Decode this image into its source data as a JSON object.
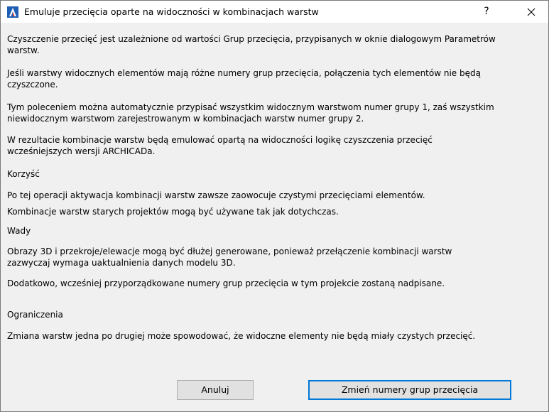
{
  "window": {
    "title": "Emuluje przecięcia oparte na widoczności w kombinacjach warstw",
    "help_label": "?",
    "close_label": "✕",
    "icon": "archicad-app-icon"
  },
  "body": {
    "p1": "Czyszczenie przecięć jest uzależnione od wartości Grup przecięcia, przypisanych w oknie dialogowym Parametrów\nwarstw.",
    "p2": "Jeśli warstwy widocznych elementów mają różne numery grup przecięcia, połączenia tych elementów nie będą\nczyszczone.",
    "p3": "Tym poleceniem można automatycznie przypisać wszystkim widocznym warstwom numer grupy 1, zaś wszystkim\nniewidocznym warstwom zarejestrowanym w kombinacjach warstw numer grupy 2.",
    "p4": "W rezultacie kombinacje warstw będą emulować opartą na widoczności logikę czyszczenia przecięć\nwcześniejszych wersji ARCHICADa.",
    "h_benefit": "Korzyść",
    "p5": "Po tej operacji aktywacja kombinacji warstw zawsze zaowocuje czystymi przecięciami elementów.",
    "p6": "Kombinacje warstw starych projektów mogą być używane tak jak dotychczas.",
    "h_drawbacks": "Wady",
    "p7": "Obrazy 3D i przekroje/elewacje mogą być dłużej generowane, ponieważ przełączenie kombinacji warstw\nzazwyczaj wymaga uaktualnienia danych modelu 3D.",
    "p8": "Dodatkowo, wcześniej przyporządkowane numery grup przecięcia w tym projekcie zostaną nadpisane.",
    "h_limits": "Ograniczenia",
    "p9": "Zmiana warstw jedna po drugiej może spowodować, że widoczne elementy nie będą miały czystych przecięć."
  },
  "buttons": {
    "cancel_label": "Anuluj",
    "confirm_label": "Zmień numery grup przecięcia"
  },
  "colors": {
    "accent": "#0078d7",
    "dialog_bg": "#f0f0f0",
    "button_bg": "#e1e1e1"
  }
}
